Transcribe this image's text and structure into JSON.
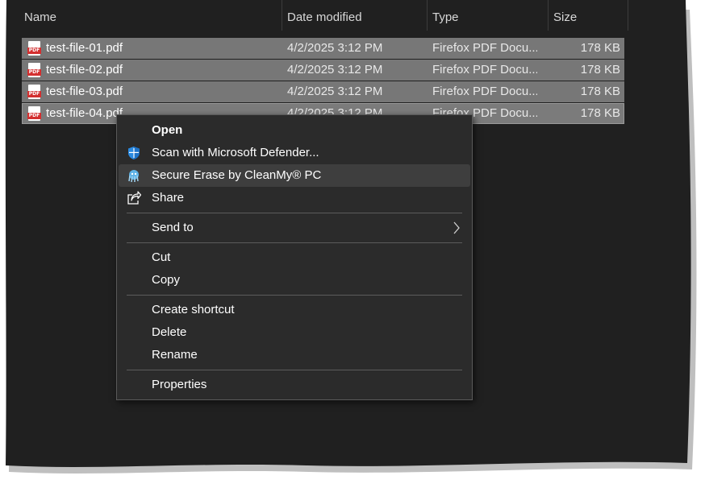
{
  "columns": {
    "name": "Name",
    "date": "Date modified",
    "type": "Type",
    "size": "Size"
  },
  "files": [
    {
      "name": "test-file-01.pdf",
      "date": "4/2/2025 3:12 PM",
      "type": "Firefox PDF Docu...",
      "size": "178 KB"
    },
    {
      "name": "test-file-02.pdf",
      "date": "4/2/2025 3:12 PM",
      "type": "Firefox PDF Docu...",
      "size": "178 KB"
    },
    {
      "name": "test-file-03.pdf",
      "date": "4/2/2025 3:12 PM",
      "type": "Firefox PDF Docu...",
      "size": "178 KB"
    },
    {
      "name": "test-file-04.pdf",
      "date": "4/2/2025 3:12 PM",
      "type": "Firefox PDF Docu...",
      "size": "178 KB"
    }
  ],
  "context_menu": {
    "open": "Open",
    "scan": "Scan with Microsoft Defender...",
    "secure_erase": "Secure Erase by CleanMy® PC",
    "share": "Share",
    "send_to": "Send to",
    "cut": "Cut",
    "copy": "Copy",
    "create_shortcut": "Create shortcut",
    "delete": "Delete",
    "rename": "Rename",
    "properties": "Properties"
  },
  "icons": {
    "file": "pdf-file-icon",
    "scan": "shield-icon",
    "secure_erase": "cleanmy-pc-icon",
    "share": "share-icon",
    "send_to": "chevron-right-icon"
  },
  "colors": {
    "window_bg": "#202020",
    "selection": "#777777",
    "menu_bg": "#2b2b2b",
    "menu_hover": "#3e3e3e"
  }
}
